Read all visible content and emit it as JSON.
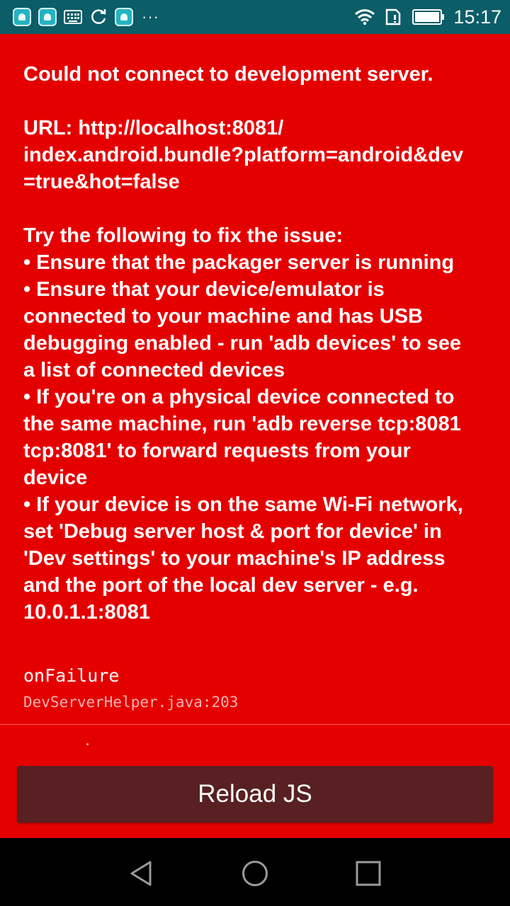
{
  "status_bar": {
    "time": "15:17",
    "more": "···",
    "icons": [
      "app-notification-icon",
      "app-notification-icon",
      "keyboard-icon",
      "sync-icon",
      "app-notification-icon",
      "more-notifications-icon",
      "wifi-icon",
      "sim-card-icon",
      "battery-icon"
    ]
  },
  "error": {
    "message": "Could not connect to development server.\n\nURL: http://localhost:8081/\nindex.android.bundle?platform=android&dev\n=true&hot=false\n\nTry the following to fix the issue:\n• Ensure that the packager server is running\n• Ensure that your device/emulator is\nconnected to your machine and has USB\ndebugging enabled - run 'adb devices' to see\na list of connected devices\n• If you're on a physical device connected to\nthe same machine, run 'adb reverse tcp:8081\ntcp:8081' to forward requests from your\ndevice\n• If your device is on the same Wi-Fi network,\nset 'Debug server host & port for device' in\n'Dev settings' to your machine's IP address\nand the port of the local dev server - e.g.\n10.0.1.1:8081"
  },
  "stack": {
    "method": "onFailure",
    "file": "DevServerHelper.java:203"
  },
  "actions": {
    "reload_label": "Reload JS"
  },
  "nav_bar": {
    "buttons": [
      "back-icon",
      "home-icon",
      "recents-icon"
    ]
  },
  "colors": {
    "background": "#e50000",
    "status_bar": "#0b5d67",
    "button": "#582022",
    "nav_bar": "#000000"
  }
}
